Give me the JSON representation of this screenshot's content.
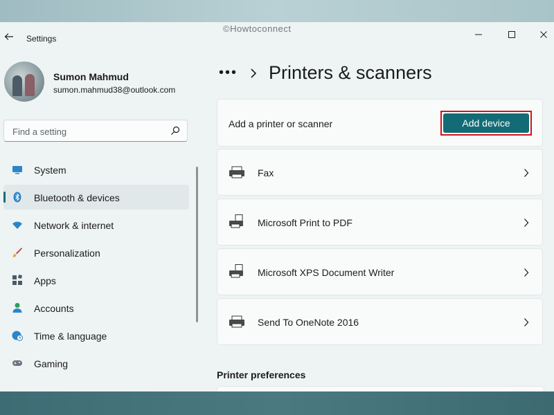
{
  "watermark": "©Howtoconnect",
  "app": {
    "title": "Settings"
  },
  "profile": {
    "name": "Sumon Mahmud",
    "email": "sumon.mahmud38@outlook.com"
  },
  "search": {
    "placeholder": "Find a setting"
  },
  "nav": {
    "items": [
      {
        "label": "System",
        "icon": "monitor-icon"
      },
      {
        "label": "Bluetooth & devices",
        "icon": "bluetooth-icon",
        "active": true
      },
      {
        "label": "Network & internet",
        "icon": "wifi-icon"
      },
      {
        "label": "Personalization",
        "icon": "brush-icon"
      },
      {
        "label": "Apps",
        "icon": "apps-icon"
      },
      {
        "label": "Accounts",
        "icon": "person-icon"
      },
      {
        "label": "Time & language",
        "icon": "globe-clock-icon"
      },
      {
        "label": "Gaming",
        "icon": "gamepad-icon"
      }
    ]
  },
  "breadcrumb": {
    "dots": "•••",
    "title": "Printers & scanners"
  },
  "add_section": {
    "label": "Add a printer or scanner",
    "button": "Add device"
  },
  "printers": [
    {
      "name": "Fax",
      "icon": "fax-icon"
    },
    {
      "name": "Microsoft Print to PDF",
      "icon": "printer-doc-icon"
    },
    {
      "name": "Microsoft XPS Document Writer",
      "icon": "printer-doc-icon"
    },
    {
      "name": "Send To OneNote 2016",
      "icon": "printer-icon"
    }
  ],
  "preferences": {
    "heading": "Printer preferences"
  },
  "colors": {
    "accent": "#136c75",
    "highlight_border": "#d3141b"
  }
}
